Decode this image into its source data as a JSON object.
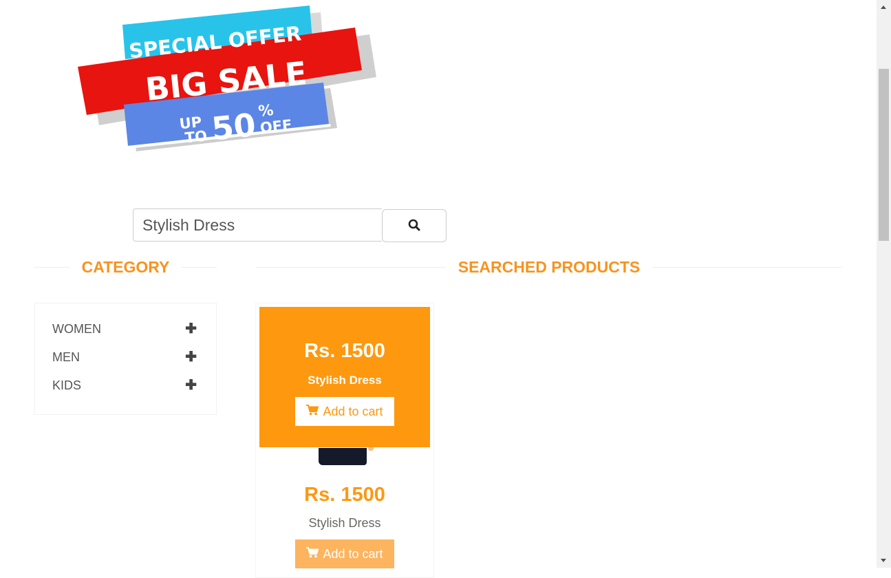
{
  "banner": {
    "line1": "SPECIAL OFFER",
    "line2": "BIG SALE",
    "line3_up": "UP",
    "line3_to": "TO",
    "line3_num": "50",
    "line3_pct": "%",
    "line3_off": "OFF"
  },
  "search": {
    "value": "Stylish Dress",
    "placeholder": "Search",
    "button_icon": "search-icon"
  },
  "category": {
    "title": "CATEGORY",
    "items": [
      {
        "label": "WOMEN",
        "icon": "plus-icon"
      },
      {
        "label": "MEN",
        "icon": "plus-icon"
      },
      {
        "label": "KIDS",
        "icon": "plus-icon"
      }
    ]
  },
  "products": {
    "title": "SEARCHED PRODUCTS",
    "items": [
      {
        "price": "Rs. 1500",
        "name": "Stylish Dress",
        "cart_label": "Add to cart",
        "cart_icon": "shopping-cart-icon"
      }
    ]
  },
  "colors": {
    "accent": "#fe980f",
    "title_orange": "#f7931e",
    "banner_red": "#e8140f",
    "banner_cyan": "#29c3ea",
    "banner_blue": "#5b86e5"
  }
}
